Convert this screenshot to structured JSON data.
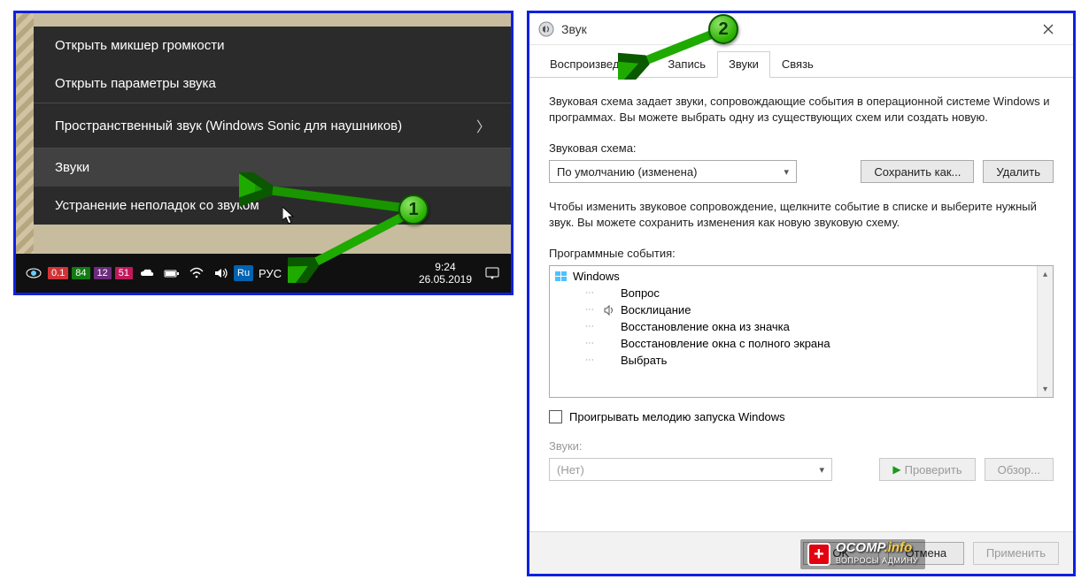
{
  "left": {
    "menu": [
      "Открыть микшер громкости",
      "Открыть параметры звука",
      "Пространственный звук (Windows Sonic для наушников)",
      "Звуки",
      "Устранение неполадок со звуком"
    ],
    "taskbar": {
      "badges": [
        "0.1",
        "84",
        "12",
        "51"
      ],
      "lang_badge": "Ru",
      "lang_text": "РУС",
      "time": "9:24",
      "date": "26.05.2019"
    }
  },
  "right": {
    "title": "Звук",
    "tabs": [
      "Воспроизведение",
      "Запись",
      "Звуки",
      "Связь"
    ],
    "active_tab": 2,
    "desc": "Звуковая схема задает звуки, сопровождающие события в операционной системе Windows и программах. Вы можете выбрать одну из существующих схем или создать новую.",
    "scheme_label": "Звуковая схема:",
    "scheme_value": "По умолчанию (изменена)",
    "btn_saveas": "Сохранить как...",
    "btn_delete": "Удалить",
    "desc2": "Чтобы изменить звуковое сопровождение, щелкните событие в списке и выберите нужный звук. Вы можете сохранить изменения как новую звуковую схему.",
    "events_label": "Программные события:",
    "events_root": "Windows",
    "events": [
      {
        "label": "Вопрос",
        "icon": false
      },
      {
        "label": "Восклицание",
        "icon": true
      },
      {
        "label": "Восстановление окна из значка",
        "icon": false
      },
      {
        "label": "Восстановление окна с полного экрана",
        "icon": false
      },
      {
        "label": "Выбрать",
        "icon": false
      }
    ],
    "chk_label": "Проигрывать мелодию запуска Windows",
    "sounds_label": "Звуки:",
    "sounds_value": "(Нет)",
    "btn_test": "Проверить",
    "btn_browse": "Обзор...",
    "btn_ok": "OK",
    "btn_cancel": "Отмена",
    "btn_apply": "Применить"
  },
  "markers": {
    "m1": "1",
    "m2": "2"
  },
  "watermark": {
    "main": "OCOMP",
    "suffix": ".info",
    "sub": "ВОПРОСЫ АДМИНУ"
  }
}
